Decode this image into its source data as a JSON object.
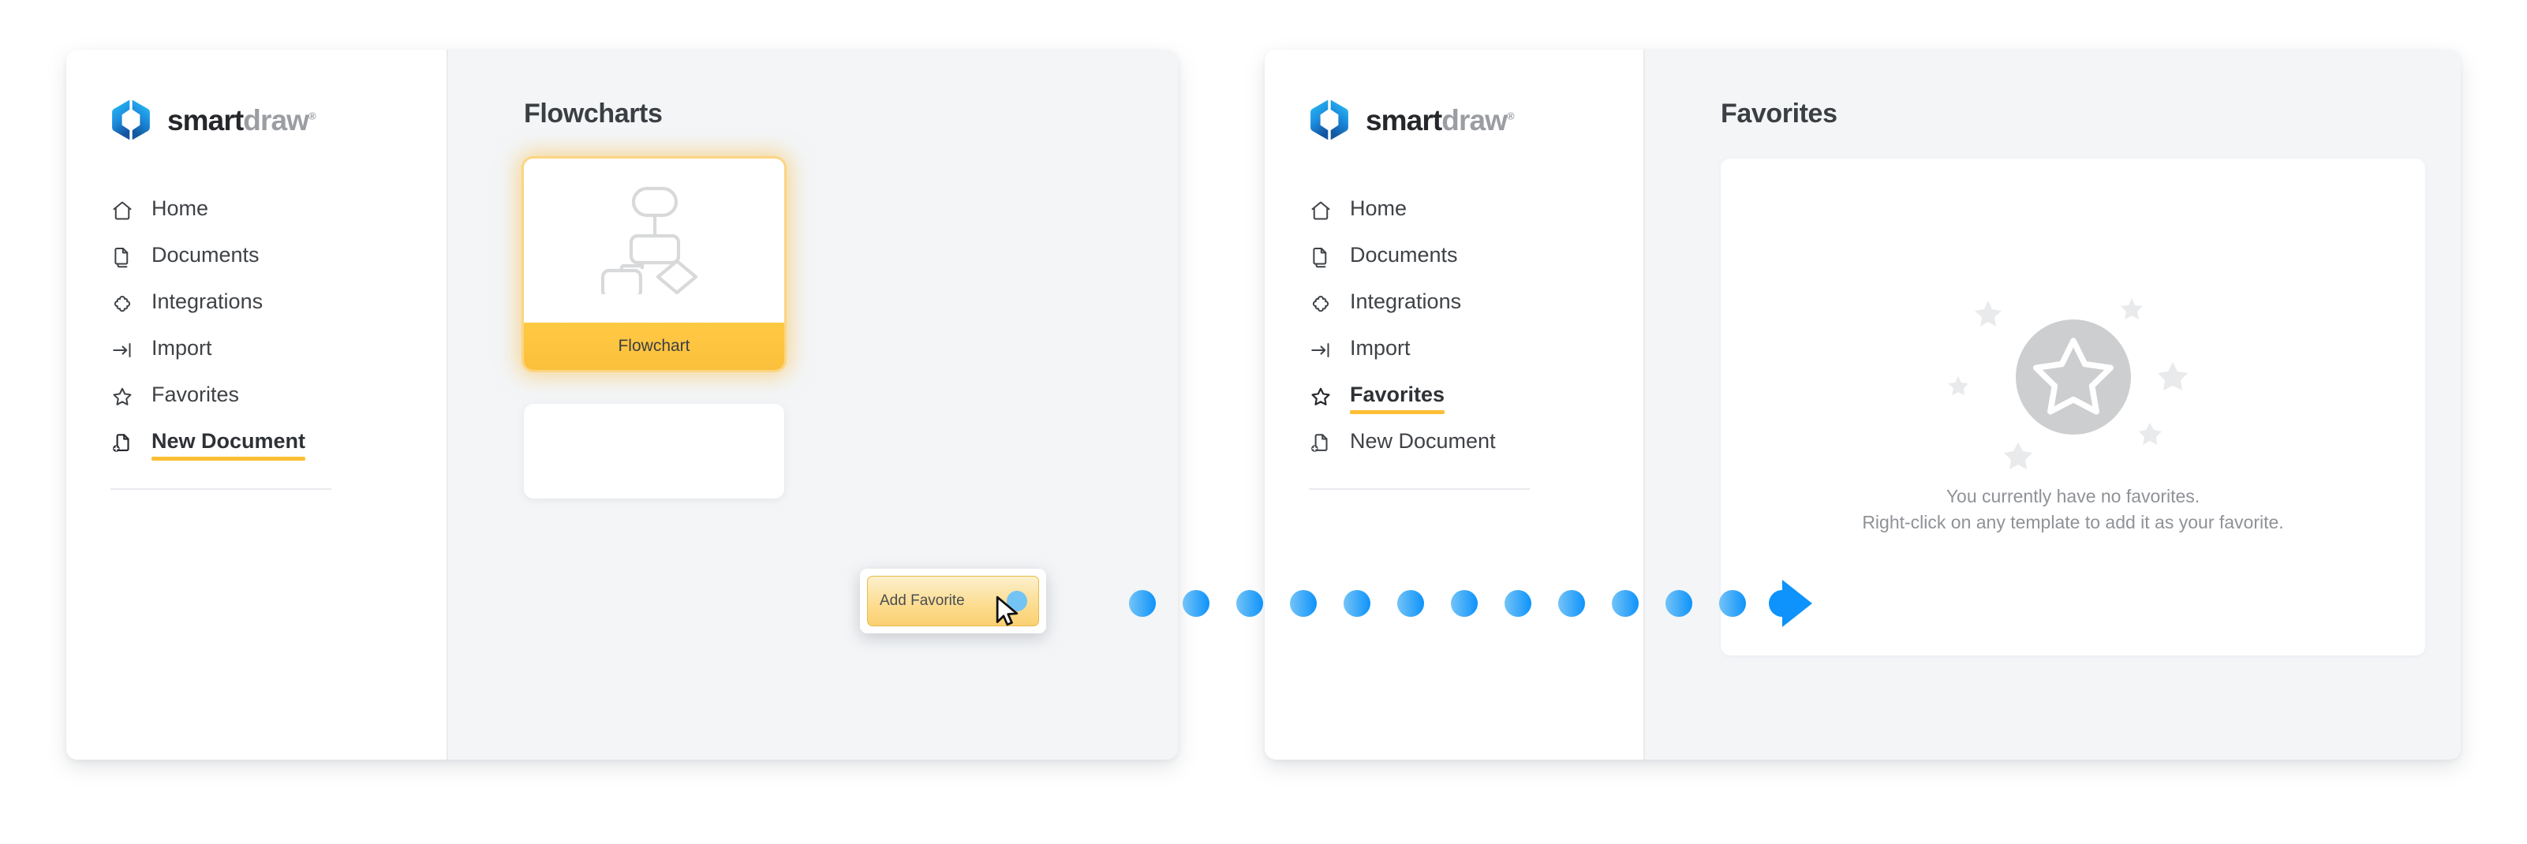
{
  "brand": {
    "name_dark": "smart",
    "name_gray": "draw",
    "registered": "®",
    "logo_icon": "smartdraw-hexagon-logo"
  },
  "colors": {
    "accent_orange": "#fbbe34",
    "card_bar": "#ffc944",
    "dot_blue": "#1a9bfc",
    "panel_bg": "#f3f5f7",
    "text_dark": "#3f4246",
    "muted": "#8f9297"
  },
  "left_panel": {
    "sidebar": {
      "items": [
        {
          "label": "Home",
          "icon": "home-icon",
          "active": false
        },
        {
          "label": "Documents",
          "icon": "documents-icon",
          "active": false
        },
        {
          "label": "Integrations",
          "icon": "integrations-icon",
          "active": false
        },
        {
          "label": "Import",
          "icon": "import-icon",
          "active": false
        },
        {
          "label": "Favorites",
          "icon": "star-icon",
          "active": false
        },
        {
          "label": "New Document",
          "icon": "new-document-icon",
          "active": true
        }
      ]
    },
    "content": {
      "title": "Flowcharts",
      "template_card": {
        "label": "Flowchart",
        "thumbnail_icon": "flowchart-diagram-icon"
      }
    },
    "context_menu": {
      "item_label": "Add Favorite",
      "indicator": "blue-dot"
    },
    "cursor": {
      "type": "arrow-pointer"
    }
  },
  "right_panel": {
    "sidebar": {
      "items": [
        {
          "label": "Home",
          "icon": "home-icon",
          "active": false
        },
        {
          "label": "Documents",
          "icon": "documents-icon",
          "active": false
        },
        {
          "label": "Integrations",
          "icon": "integrations-icon",
          "active": false
        },
        {
          "label": "Import",
          "icon": "import-icon",
          "active": false
        },
        {
          "label": "Favorites",
          "icon": "star-icon",
          "active": true
        },
        {
          "label": "New Document",
          "icon": "new-document-icon",
          "active": false
        }
      ]
    },
    "content": {
      "title": "Favorites",
      "empty_state": {
        "illustration": "star-in-circle-with-sparkles",
        "line1": "You currently have no favorites.",
        "line2": "Right-click on any template to add it as your favorite."
      }
    }
  },
  "connector": {
    "type": "dotted-arrow",
    "dot_count": 14,
    "direction": "left-to-right"
  }
}
